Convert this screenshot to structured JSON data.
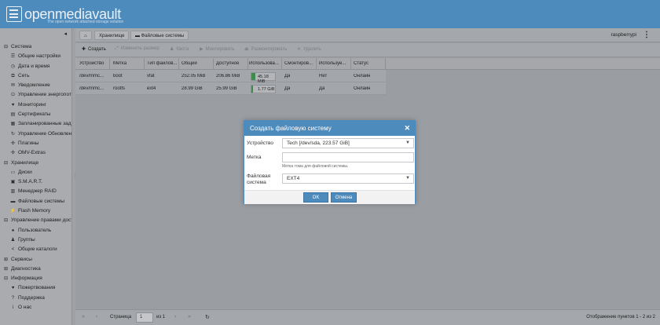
{
  "app": {
    "name": "openmediavault",
    "tagline": "The open network attached storage solution"
  },
  "sidebar": {
    "collapse_icon": "chevron-left-icon",
    "items": [
      {
        "label": "Система",
        "icon": "minus-square-icon",
        "level": "category"
      },
      {
        "label": "Общие настройки",
        "icon": "sliders-icon",
        "level": "sub"
      },
      {
        "label": "Дата и время",
        "icon": "clock-icon",
        "level": "sub"
      },
      {
        "label": "Сеть",
        "icon": "network-icon",
        "level": "sub"
      },
      {
        "label": "Уведомление",
        "icon": "envelope-icon",
        "level": "sub"
      },
      {
        "label": "Управление энергопотр",
        "icon": "power-icon",
        "level": "sub"
      },
      {
        "label": "Мониторинг",
        "icon": "heartbeat-icon",
        "level": "sub"
      },
      {
        "label": "Сертификаты",
        "icon": "certificate-icon",
        "level": "sub"
      },
      {
        "label": "Запланированные зада",
        "icon": "calendar-icon",
        "level": "sub"
      },
      {
        "label": "Управление Обновлени",
        "icon": "sync-icon",
        "level": "sub"
      },
      {
        "label": "Плагины",
        "icon": "puzzle-icon",
        "level": "sub"
      },
      {
        "label": "OMV-Extras",
        "icon": "puzzle-icon",
        "level": "sub"
      },
      {
        "label": "Хранилище",
        "icon": "minus-square-icon",
        "level": "category"
      },
      {
        "label": "Диски",
        "icon": "disk-icon",
        "level": "sub"
      },
      {
        "label": "S.M.A.R.T.",
        "icon": "smart-icon",
        "level": "sub"
      },
      {
        "label": "Менеджер RAID",
        "icon": "raid-icon",
        "level": "sub"
      },
      {
        "label": "Файловые системы",
        "icon": "filesystem-icon",
        "level": "sub"
      },
      {
        "label": "Flash Memory",
        "icon": "bolt-icon",
        "level": "sub"
      },
      {
        "label": "Управление правами досту",
        "icon": "minus-square-icon",
        "level": "category"
      },
      {
        "label": "Пользователь",
        "icon": "user-icon",
        "level": "sub"
      },
      {
        "label": "Группы",
        "icon": "users-icon",
        "level": "sub"
      },
      {
        "label": "Общие каталоги",
        "icon": "share-icon",
        "level": "sub"
      },
      {
        "label": "Сервисы",
        "icon": "plus-square-icon",
        "level": "category"
      },
      {
        "label": "Диагностика",
        "icon": "plus-square-icon",
        "level": "category"
      },
      {
        "label": "Информация",
        "icon": "minus-square-icon",
        "level": "category"
      },
      {
        "label": "Пожертвования",
        "icon": "heart-icon",
        "level": "sub"
      },
      {
        "label": "Поддержка",
        "icon": "help-icon",
        "level": "sub"
      },
      {
        "label": "О нас",
        "icon": "info-icon",
        "level": "sub"
      }
    ]
  },
  "breadcrumb": {
    "home_icon": "home-icon",
    "items": [
      "Хранилище",
      "Файловые системы"
    ]
  },
  "user": {
    "name": "raspberrypi"
  },
  "toolbar": {
    "create": "Создать",
    "resize": "Изменить размер",
    "quota": "Квота",
    "mount": "Монтировать",
    "unmount": "Размонтировать",
    "delete": "Удалить"
  },
  "table": {
    "columns": [
      "Устройство",
      "Метка",
      "Тип файлов...",
      "Общий",
      "Доступное",
      "Использова...",
      "Смонтиров...",
      "Используе...",
      "Статус"
    ],
    "rows": [
      {
        "device": "/dev/mmc...",
        "label": "boot",
        "type": "vfat",
        "total": "252.05 MiB",
        "available": "206.86 MiB",
        "used": "45.18 MiB",
        "used_fraction": 0.18,
        "mounted": "Да",
        "referenced": "Нет",
        "status": "Онлайн"
      },
      {
        "device": "/dev/mmc...",
        "label": "rootfs",
        "type": "ext4",
        "total": "28.99 GiB",
        "available": "25.99 GiB",
        "used": "1.77 GiB",
        "used_fraction": 0.06,
        "mounted": "Да",
        "referenced": "Да",
        "status": "Онлайн"
      }
    ]
  },
  "pager": {
    "page_label": "Страница",
    "page": "1",
    "of_label": "из 1",
    "info": "Отображение пунктов 1 - 2 из 2"
  },
  "dialog": {
    "title": "Создать файловую систему",
    "device_label": "Устройство",
    "device_value": "Tech [/dev/sda, 223.57 GiB]",
    "label_label": "Метка",
    "label_value": "",
    "label_hint": "Метка тома для файловой системы.",
    "fs_label_line1": "Файловая",
    "fs_label_line2": "система",
    "fs_value": "EXT4",
    "ok": "OK",
    "cancel": "Отмена"
  },
  "colors": {
    "header": "#4e8bbd",
    "accent": "#4e8bbd",
    "usage_bar": "#3f8a4e",
    "dimmed_bg": "#9a9da2"
  }
}
